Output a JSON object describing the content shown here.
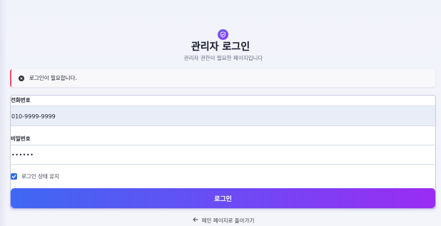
{
  "header": {
    "icon": "shield-check-icon",
    "title": "관리자 로그인",
    "subtitle": "관리자 권한이 필요한 페이지입니다"
  },
  "alert": {
    "icon": "alert-circle-icon",
    "message": "로그인이 필요합니다.",
    "accent_color": "#ee4f63"
  },
  "form": {
    "phone_label": "전화번호",
    "phone_value": "010-9999-9999",
    "password_label": "비밀번호",
    "password_value": "••••••",
    "remember_label": "로그인 상태 유지",
    "remember_checked": true,
    "submit_label": "로그인"
  },
  "footer": {
    "back_icon": "arrow-left-icon",
    "back_label": "메인 페이지로 돌아가기"
  },
  "colors": {
    "button_gradient_start": "#3f68f3",
    "button_gradient_end": "#9a2cf3",
    "checkbox": "#2f6ee8"
  }
}
